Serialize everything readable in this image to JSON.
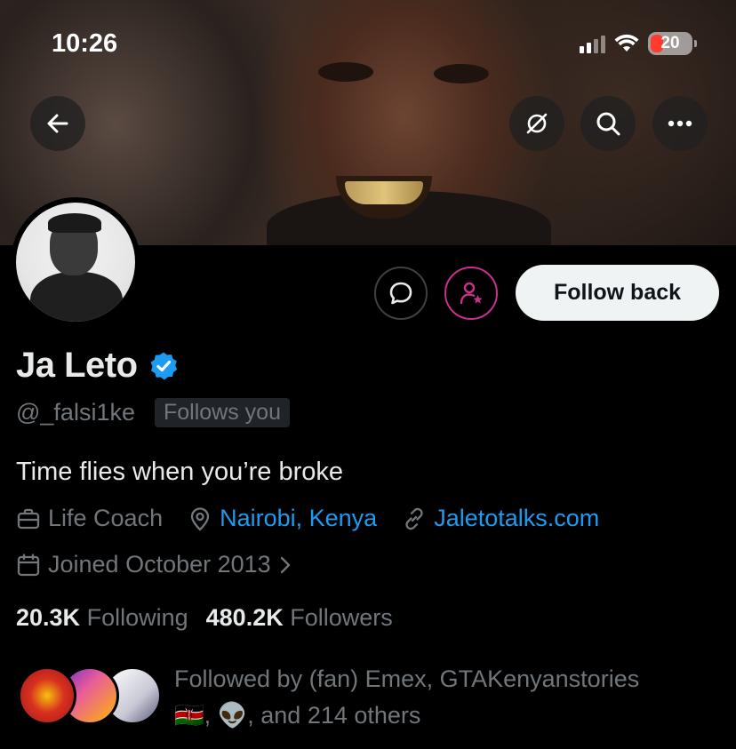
{
  "status_bar": {
    "time": "10:26",
    "battery": "20"
  },
  "profile": {
    "name": "Ja Leto",
    "handle": "@_falsi1ke",
    "follows_you": "Follows you",
    "bio": "Time flies when you’re broke",
    "category": "Life Coach",
    "location": "Nairobi, Kenya",
    "website": "Jaletotalks.com",
    "joined": "Joined October 2013",
    "following_count": "20.3K",
    "following_label": "Following",
    "followers_count": "480.2K",
    "followers_label": "Followers",
    "verified": true
  },
  "actions": {
    "follow_back": "Follow back"
  },
  "followed_by": {
    "line1": "Followed by (fan) Emex, GTAKenyanstories",
    "line2_flag": "🇰🇪",
    "line2_alien": "👽",
    "line2_rest": ", and 214 others"
  },
  "colors": {
    "accent_blue": "#1d9bf0",
    "subscribe_pink": "#c9308c",
    "muted": "#71767b"
  }
}
